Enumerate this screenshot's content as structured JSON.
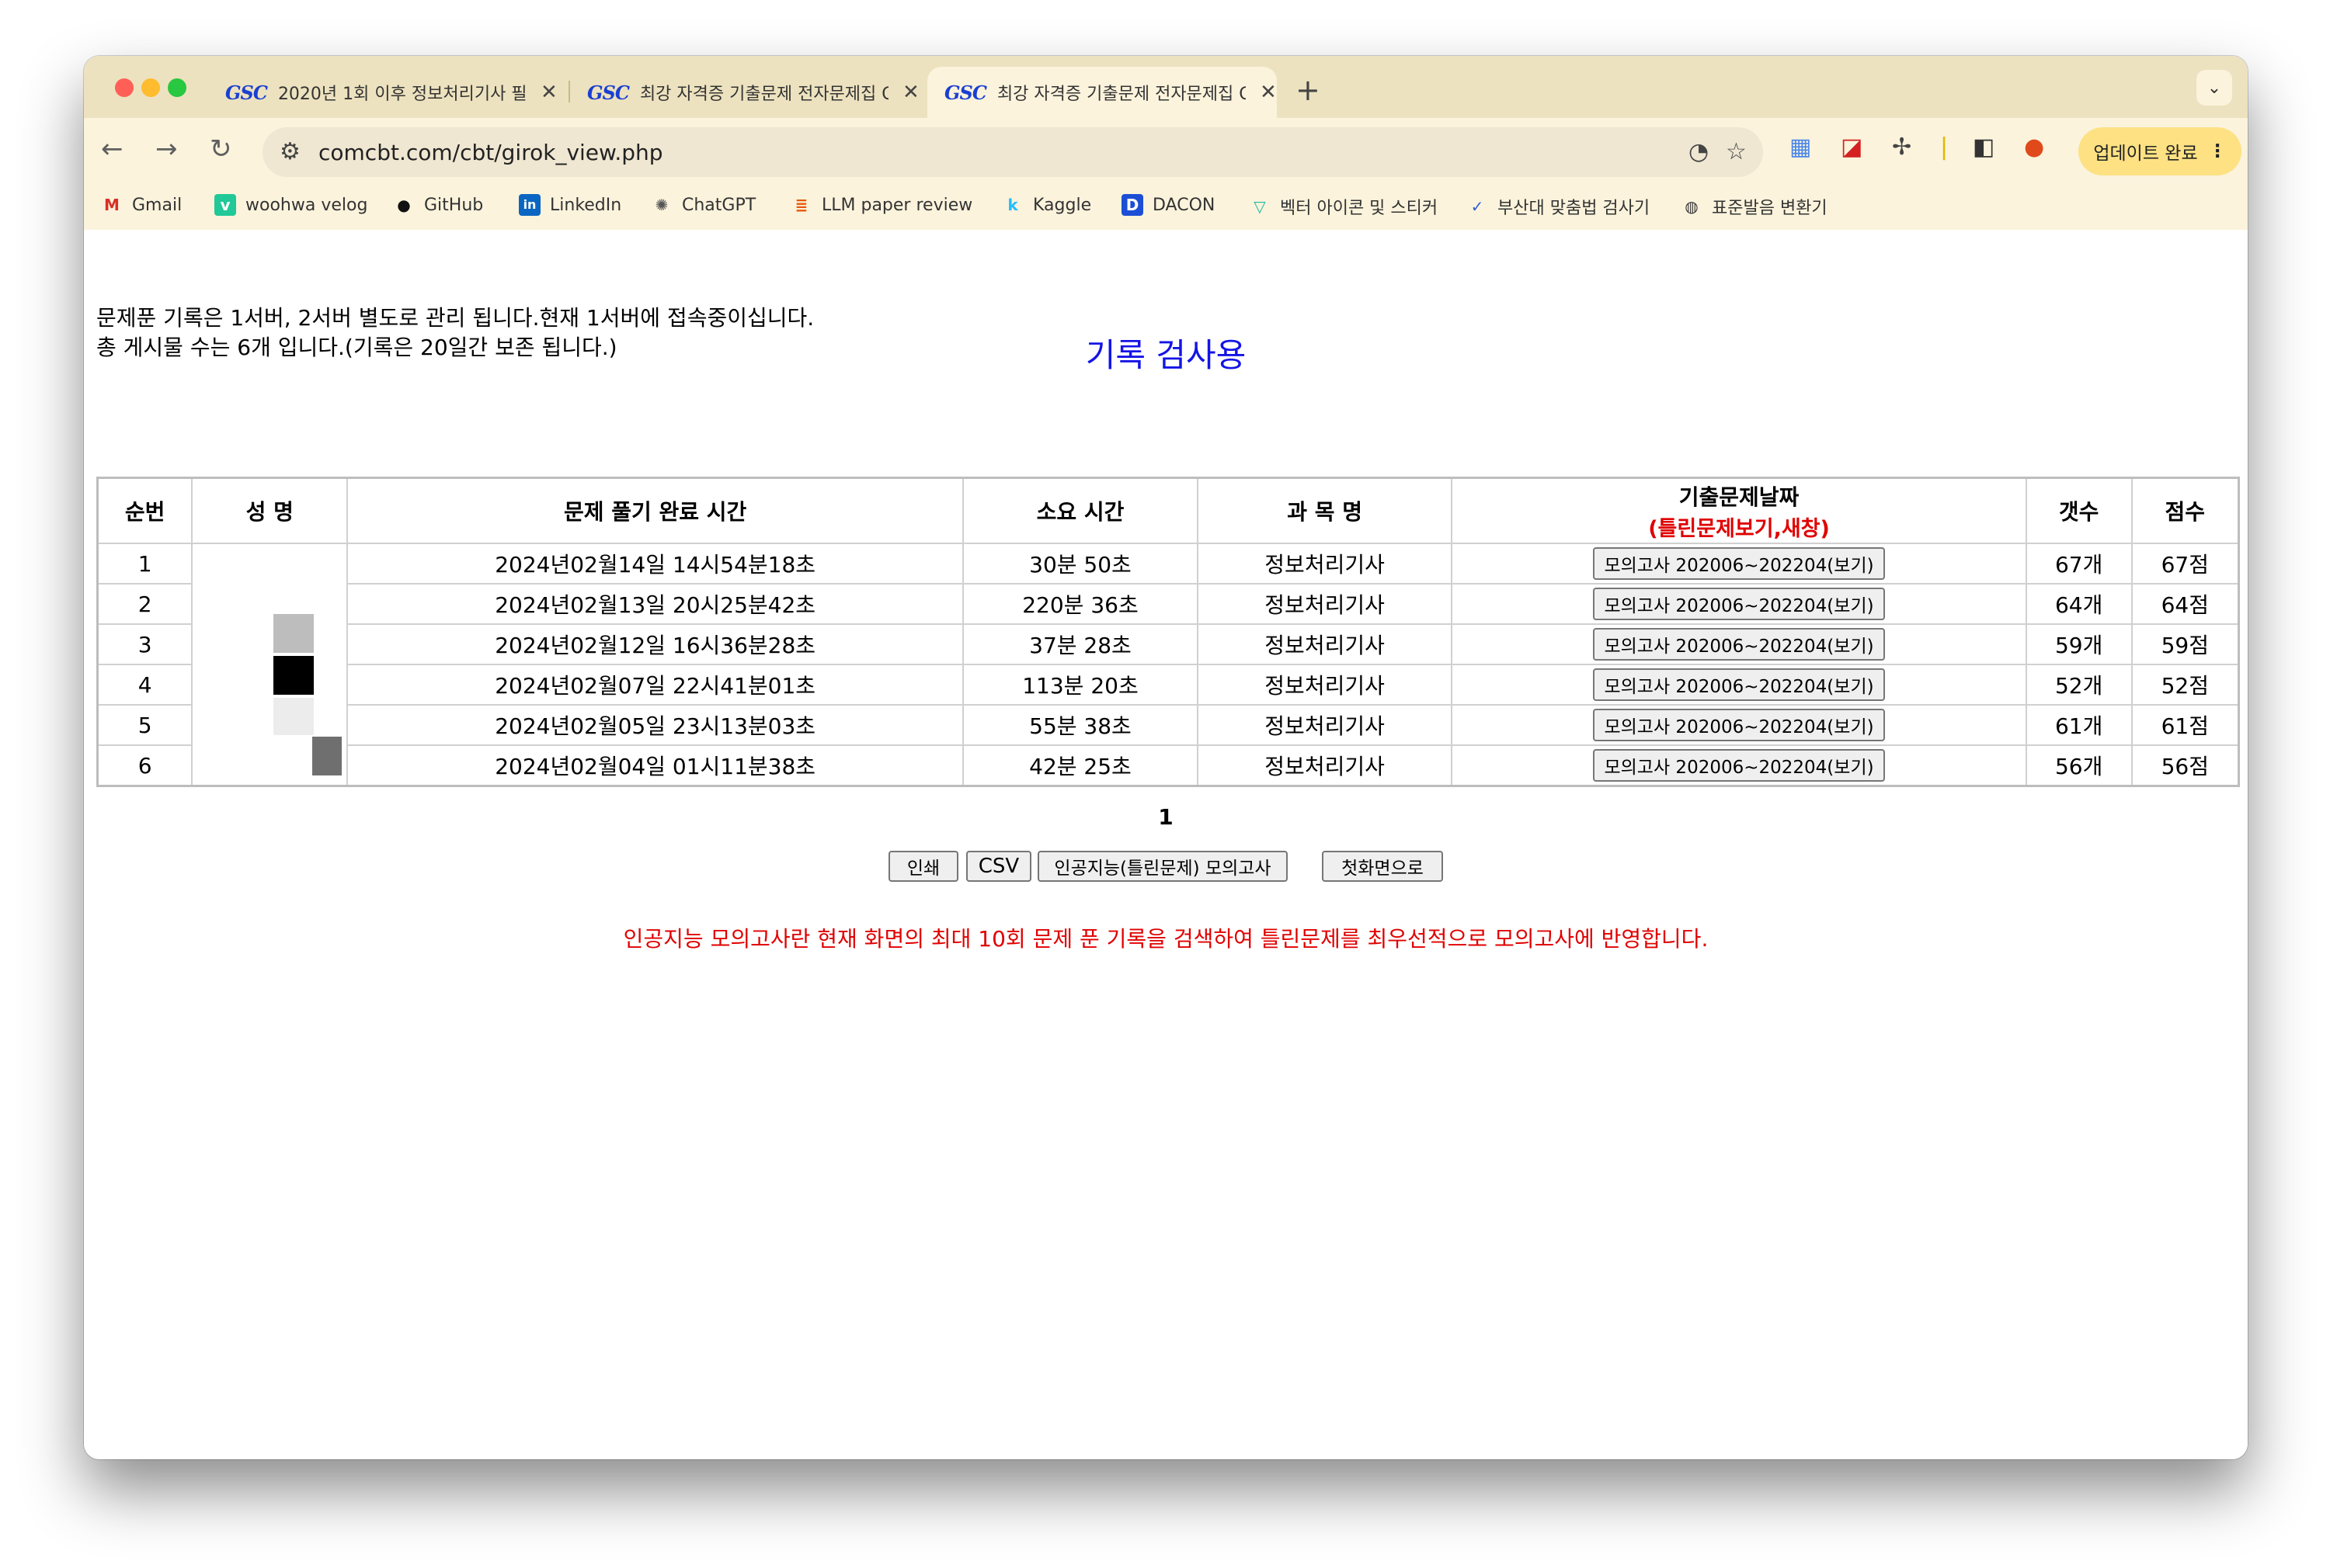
{
  "browser": {
    "tabs": [
      {
        "favicon": "GSC",
        "title": "2020년 1회 이후 정보처리기사 필..."
      },
      {
        "favicon": "GSC",
        "title": "최강 자격증 기출문제 전자문제집 C..."
      },
      {
        "favicon": "GSC",
        "title": "최강 자격증 기출문제 전자문제집 C..."
      }
    ],
    "new_tab": "+",
    "tab_menu": "⌄",
    "close_glyph": "✕",
    "url": "comcbt.com/cbt/girok_view.php",
    "update_button": "업데이트 완료"
  },
  "bookmarks": [
    {
      "label": "Gmail",
      "icon": "M"
    },
    {
      "label": "woohwa velog",
      "icon": "v"
    },
    {
      "label": "GitHub",
      "icon": "●"
    },
    {
      "label": "LinkedIn",
      "icon": "in"
    },
    {
      "label": "ChatGPT",
      "icon": "✺"
    },
    {
      "label": "LLM paper review",
      "icon": "≣"
    },
    {
      "label": "Kaggle",
      "icon": "k"
    },
    {
      "label": "DACON",
      "icon": "D"
    },
    {
      "label": "벡터 아이콘 및 스티커",
      "icon": "▽"
    },
    {
      "label": "부산대 맞춤법 검사기",
      "icon": "✓"
    },
    {
      "label": "표준발음 변환기",
      "icon": "◍"
    }
  ],
  "page": {
    "info_line1": "문제푼 기록은 1서버, 2서버 별도로 관리 됩니다.현재 1서버에 접속중이십니다.",
    "info_line2": "총 게시물 수는 6개 입니다.(기록은 20일간 보존 됩니다.)",
    "heading": "기록 검사용",
    "table": {
      "headers": {
        "no": "순번",
        "name": "성 명",
        "time": "문제 풀기 완료 시간",
        "duration": "소요 시간",
        "subject": "과 목 명",
        "exam_date": "기출문제날짜",
        "exam_date_sub": "(틀린문제보기,새창)",
        "count": "갯수",
        "score": "점수"
      },
      "rows": [
        {
          "no": "1",
          "time": "2024년02월14일 14시54분18초",
          "duration": "30분 50초",
          "subject": "정보처리기사",
          "exam": "모의고사 202006~202204(보기)",
          "count": "67개",
          "score": "67점"
        },
        {
          "no": "2",
          "time": "2024년02월13일 20시25분42초",
          "duration": "220분 36초",
          "subject": "정보처리기사",
          "exam": "모의고사 202006~202204(보기)",
          "count": "64개",
          "score": "64점"
        },
        {
          "no": "3",
          "time": "2024년02월12일 16시36분28초",
          "duration": "37분 28초",
          "subject": "정보처리기사",
          "exam": "모의고사 202006~202204(보기)",
          "count": "59개",
          "score": "59점"
        },
        {
          "no": "4",
          "time": "2024년02월07일 22시41분01초",
          "duration": "113분 20초",
          "subject": "정보처리기사",
          "exam": "모의고사 202006~202204(보기)",
          "count": "52개",
          "score": "52점"
        },
        {
          "no": "5",
          "time": "2024년02월05일 23시13분03초",
          "duration": "55분 38초",
          "subject": "정보처리기사",
          "exam": "모의고사 202006~202204(보기)",
          "count": "61개",
          "score": "61점"
        },
        {
          "no": "6",
          "time": "2024년02월04일 01시11분38초",
          "duration": "42분 25초",
          "subject": "정보처리기사",
          "exam": "모의고사 202006~202204(보기)",
          "count": "56개",
          "score": "56점"
        }
      ]
    },
    "page_number": "1",
    "buttons": {
      "print": "인쇄",
      "csv": "CSV",
      "ai_exam": "인공지능(틀린문제) 모의고사",
      "home": "첫화면으로"
    },
    "note": "인공지능 모의고사란 현재 화면의 최대 10회 문제 푼 기록을 검색하여 틀린문제를 최우선적으로 모의고사에 반영합니다."
  },
  "colors": {
    "tab_strip": "#ede2bf",
    "toolbar": "#fbf3dc",
    "heading": "#1414e6",
    "note": "#e00000",
    "update_button": "#fde183"
  }
}
